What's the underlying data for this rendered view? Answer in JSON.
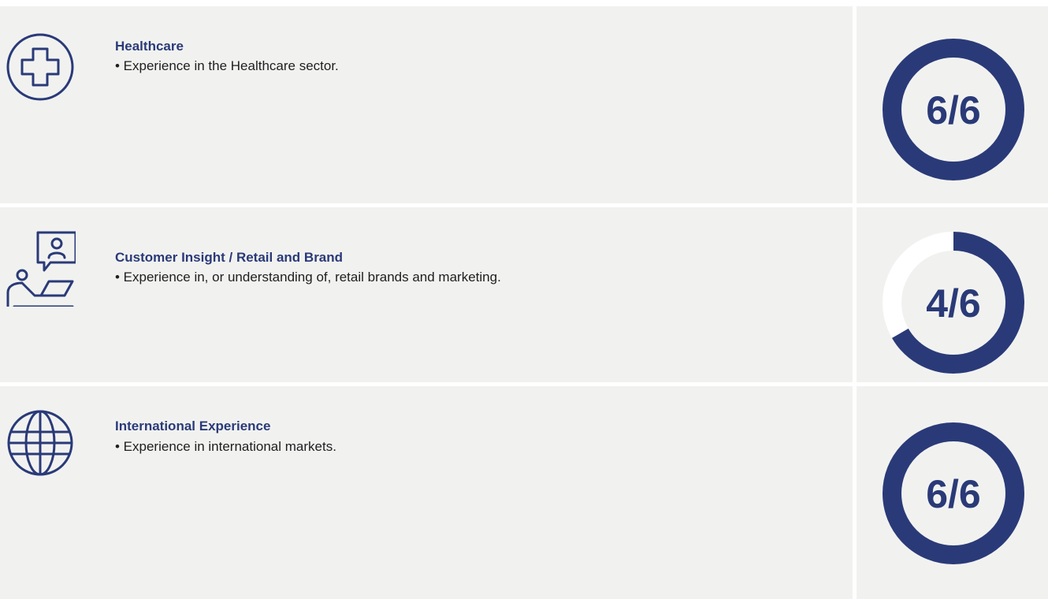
{
  "colors": {
    "accent": "#2a3a78",
    "track": "#ffffff",
    "panel": "#f1f2f0",
    "text": "#1e1e1e"
  },
  "rows": [
    {
      "icon": "medical-cross-icon",
      "title": "Healthcare",
      "description": "• Experience in the Healthcare sector.",
      "score": {
        "label": "6/6",
        "value": 6,
        "max": 6
      }
    },
    {
      "icon": "customer-laptop-chat-icon",
      "title": "Customer Insight / Retail and Brand",
      "description": "• Experience in, or understanding of, retail brands and marketing.",
      "score": {
        "label": "4/6",
        "value": 4,
        "max": 6
      }
    },
    {
      "icon": "globe-icon",
      "title": "International Experience",
      "description": "• Experience in international markets.",
      "score": {
        "label": "6/6",
        "value": 6,
        "max": 6
      }
    }
  ]
}
